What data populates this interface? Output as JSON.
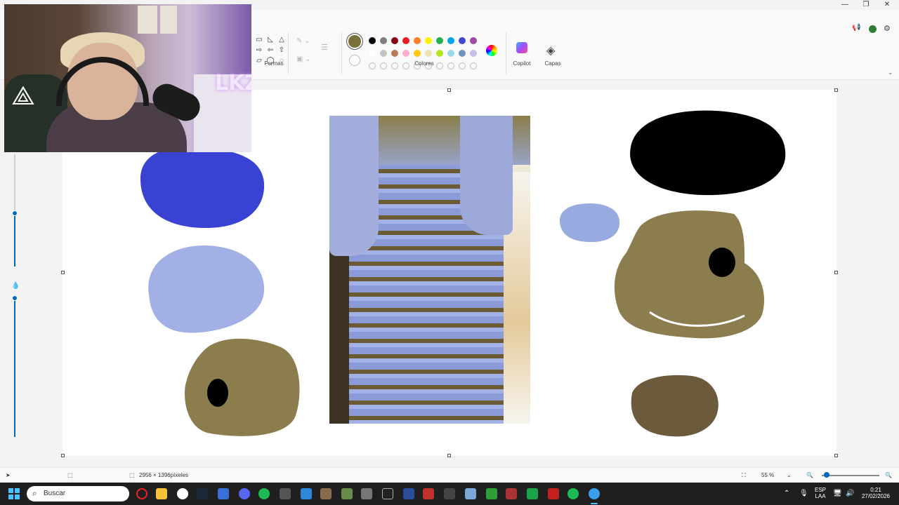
{
  "ribbon": {
    "groups": {
      "shapes_label": "Formas",
      "colors_label": "Colores",
      "copilot_label": "Copilot",
      "layers_label": "Capas"
    },
    "shape_icons": [
      "square-outline-icon",
      "triangle-right-icon",
      "triangle-icon",
      "arrow-right-icon",
      "arrow-left-icon",
      "arrow-up-icon",
      "speech-bubble-icon",
      "speech-oval-icon",
      "speech-round-icon"
    ],
    "current_color": "#7b6f3c",
    "palette_row1": [
      "#000000",
      "#7f7f7f",
      "#880015",
      "#ed1c24",
      "#ff7f27",
      "#fff200",
      "#22b14c",
      "#00a2e8",
      "#3f48cc",
      "#a349a4"
    ],
    "palette_row2": [
      "#ffffff",
      "#c3c3c3",
      "#b97a57",
      "#ffaec9",
      "#ffc90e",
      "#efe4b0",
      "#b5e61d",
      "#99d9ea",
      "#7092be",
      "#c8bfe7"
    ]
  },
  "canvas": {
    "blobs": [
      {
        "name": "blue-blob",
        "color": "#3a42d4"
      },
      {
        "name": "light-blue-blob",
        "color": "#a2b0e6"
      },
      {
        "name": "gold-blob-with-dot",
        "color": "#8b7d4e"
      },
      {
        "name": "black-blob",
        "color": "#000000"
      },
      {
        "name": "small-light-blue-blob",
        "color": "#98abe0"
      },
      {
        "name": "large-gold-blob",
        "color": "#8b7d4e"
      },
      {
        "name": "brown-blob",
        "color": "#6b5a3c"
      }
    ]
  },
  "webcam": {
    "neon_text": "LKZ"
  },
  "statusbar": {
    "dimensions": "2956 × 1396píxeles",
    "zoom": "55 %"
  },
  "taskbar": {
    "search_placeholder": "Buscar",
    "lang_top": "ESP",
    "lang_bottom": "LAA",
    "time": "0:21",
    "date": "27/02/2026"
  }
}
